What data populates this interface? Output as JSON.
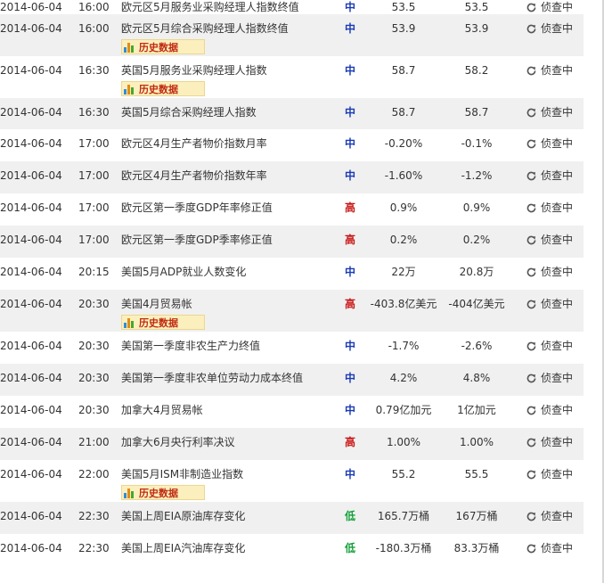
{
  "history_label": "历史数据",
  "rows": [
    {
      "date": "2014-06-04",
      "time": "16:00",
      "event": "欧元区5月服务业采购经理人指数终值",
      "importance": "中",
      "previous": "53.5",
      "forecast": "53.5",
      "actual": "侦查中",
      "history": false
    },
    {
      "date": "2014-06-04",
      "time": "16:00",
      "event": "欧元区5月综合采购经理人指数终值",
      "importance": "中",
      "previous": "53.9",
      "forecast": "53.9",
      "actual": "侦查中",
      "history": true
    },
    {
      "date": "2014-06-04",
      "time": "16:30",
      "event": "英国5月服务业采购经理人指数",
      "importance": "中",
      "previous": "58.7",
      "forecast": "58.2",
      "actual": "侦查中",
      "history": true
    },
    {
      "date": "2014-06-04",
      "time": "16:30",
      "event": "英国5月综合采购经理人指数",
      "importance": "中",
      "previous": "58.7",
      "forecast": "58.7",
      "actual": "侦查中",
      "history": false
    },
    {
      "date": "2014-06-04",
      "time": "17:00",
      "event": "欧元区4月生产者物价指数月率",
      "importance": "中",
      "previous": "-0.20%",
      "forecast": "-0.1%",
      "actual": "侦查中",
      "history": false
    },
    {
      "date": "2014-06-04",
      "time": "17:00",
      "event": "欧元区4月生产者物价指数年率",
      "importance": "中",
      "previous": "-1.60%",
      "forecast": "-1.2%",
      "actual": "侦查中",
      "history": false
    },
    {
      "date": "2014-06-04",
      "time": "17:00",
      "event": "欧元区第一季度GDP年率修正值",
      "importance": "高",
      "previous": "0.9%",
      "forecast": "0.9%",
      "actual": "侦查中",
      "history": false
    },
    {
      "date": "2014-06-04",
      "time": "17:00",
      "event": "欧元区第一季度GDP季率修正值",
      "importance": "高",
      "previous": "0.2%",
      "forecast": "0.2%",
      "actual": "侦查中",
      "history": false
    },
    {
      "date": "2014-06-04",
      "time": "20:15",
      "event": "美国5月ADP就业人数变化",
      "importance": "中",
      "previous": "22万",
      "forecast": "20.8万",
      "actual": "侦查中",
      "history": false
    },
    {
      "date": "2014-06-04",
      "time": "20:30",
      "event": "美国4月贸易帐",
      "importance": "高",
      "previous": "-403.8亿美元",
      "forecast": "-404亿美元",
      "actual": "侦查中",
      "history": true
    },
    {
      "date": "2014-06-04",
      "time": "20:30",
      "event": "美国第一季度非农生产力终值",
      "importance": "中",
      "previous": "-1.7%",
      "forecast": "-2.6%",
      "actual": "侦查中",
      "history": false
    },
    {
      "date": "2014-06-04",
      "time": "20:30",
      "event": "美国第一季度非农单位劳动力成本终值",
      "importance": "中",
      "previous": "4.2%",
      "forecast": "4.8%",
      "actual": "侦查中",
      "history": false
    },
    {
      "date": "2014-06-04",
      "time": "20:30",
      "event": "加拿大4月贸易帐",
      "importance": "中",
      "previous": "0.79亿加元",
      "forecast": "1亿加元",
      "actual": "侦查中",
      "history": false
    },
    {
      "date": "2014-06-04",
      "time": "21:00",
      "event": "加拿大6月央行利率决议",
      "importance": "高",
      "previous": "1.00%",
      "forecast": "1.00%",
      "actual": "侦查中",
      "history": false
    },
    {
      "date": "2014-06-04",
      "time": "22:00",
      "event": "美国5月ISM非制造业指数",
      "importance": "中",
      "previous": "55.2",
      "forecast": "55.5",
      "actual": "侦查中",
      "history": true
    },
    {
      "date": "2014-06-04",
      "time": "22:30",
      "event": "美国上周EIA原油库存变化",
      "importance": "低",
      "previous": "165.7万桶",
      "forecast": "167万桶",
      "actual": "侦查中",
      "history": false
    },
    {
      "date": "2014-06-04",
      "time": "22:30",
      "event": "美国上周EIA汽油库存变化",
      "importance": "低",
      "previous": "-180.3万桶",
      "forecast": "83.3万桶",
      "actual": "侦查中",
      "history": false
    }
  ]
}
